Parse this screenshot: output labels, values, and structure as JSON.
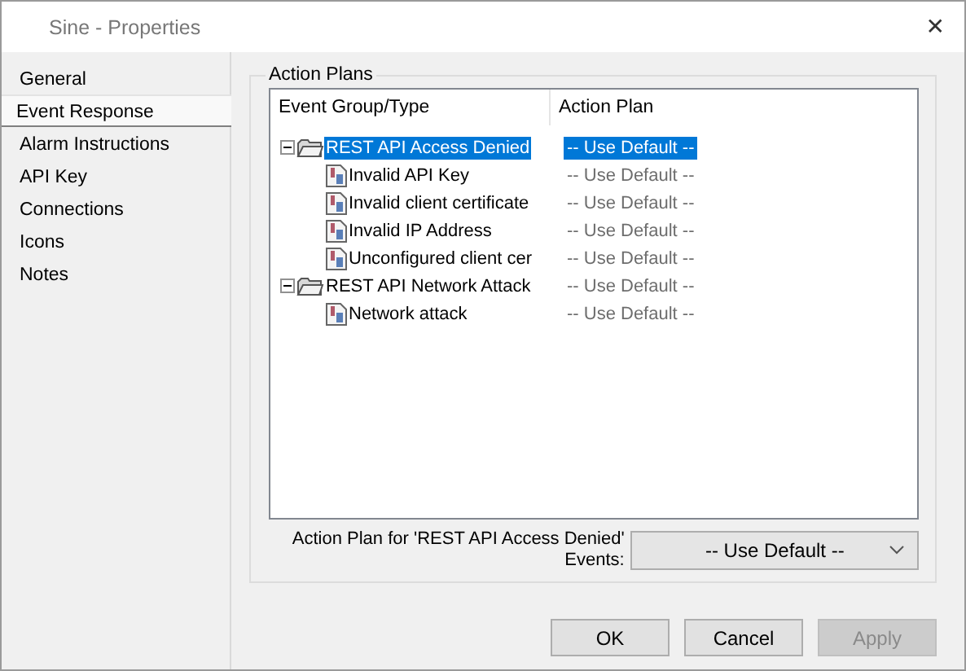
{
  "window": {
    "title": "Sine - Properties",
    "close": "✕"
  },
  "sidebar": {
    "items": [
      {
        "label": "General",
        "selected": false
      },
      {
        "label": "Event Response",
        "selected": true
      },
      {
        "label": "Alarm Instructions",
        "selected": false
      },
      {
        "label": "API Key",
        "selected": false
      },
      {
        "label": "Connections",
        "selected": false
      },
      {
        "label": "Icons",
        "selected": false
      },
      {
        "label": "Notes",
        "selected": false
      }
    ]
  },
  "group_box": {
    "title": "Action Plans"
  },
  "table": {
    "columns": [
      "Event Group/Type",
      "Action Plan"
    ],
    "rows": [
      {
        "label": "REST API Access Denied",
        "plan": "-- Use Default --",
        "selected": true,
        "expanded": true,
        "children": [
          {
            "label": "Invalid API Key",
            "plan": "-- Use Default --",
            "selected": false
          },
          {
            "label": "Invalid client certificate",
            "plan": "-- Use Default --",
            "selected": false
          },
          {
            "label": "Invalid IP Address",
            "plan": "-- Use Default --",
            "selected": false
          },
          {
            "label": "Unconfigured client cer",
            "plan": "-- Use Default --",
            "selected": false
          }
        ]
      },
      {
        "label": "REST API Network Attack",
        "plan": "-- Use Default --",
        "selected": false,
        "expanded": true,
        "children": [
          {
            "label": "Network attack",
            "plan": "-- Use Default --",
            "selected": false
          }
        ]
      }
    ]
  },
  "plan_field": {
    "label": "Action Plan for 'REST API Access Denied' Events:",
    "value": "-- Use Default --"
  },
  "buttons": [
    {
      "label": "OK",
      "disabled": false
    },
    {
      "label": "Cancel",
      "disabled": false
    },
    {
      "label": "Apply",
      "disabled": true
    }
  ]
}
